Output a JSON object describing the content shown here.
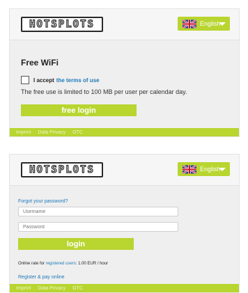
{
  "brand": {
    "logo_text": "HOTSPLOTS"
  },
  "language": {
    "selected": "English"
  },
  "free_wifi": {
    "title": "Free WiFi",
    "accept_prefix": "I accept",
    "terms_link": "the terms of use",
    "info": "The free use is limited to 100 MB per user per calendar day.",
    "button": "free login"
  },
  "login_form": {
    "forgot_link": "Forgot your password?",
    "username_placeholder": "Username",
    "password_placeholder": "Password",
    "button": "login",
    "rate_prefix": "Online rate for",
    "rate_link": "registered users",
    "rate_suffix": ": 1.00 EUR / hour",
    "register_link": "Register & pay online"
  },
  "footer": {
    "links": [
      "Imprint",
      "Data Privacy",
      "GTC"
    ]
  },
  "colors": {
    "accent": "#b8d530",
    "link": "#1e7ab8"
  }
}
